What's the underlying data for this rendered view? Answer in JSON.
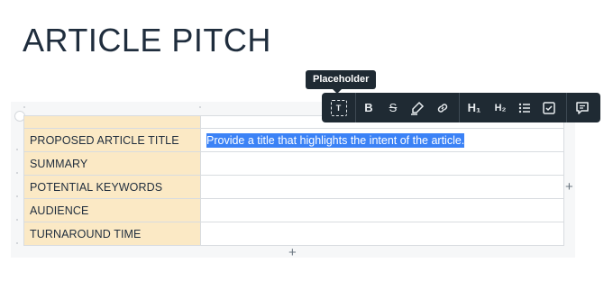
{
  "document": {
    "title": "ARTICLE PITCH"
  },
  "table": {
    "rows": [
      {
        "label": "PROPOSED ARTICLE TITLE",
        "value": "Provide a title that highlights the intent of the article."
      },
      {
        "label": "SUMMARY",
        "value": ""
      },
      {
        "label": "POTENTIAL KEYWORDS",
        "value": ""
      },
      {
        "label": "AUDIENCE",
        "value": ""
      },
      {
        "label": "TURNAROUND TIME",
        "value": ""
      }
    ],
    "add_column_glyph": "+",
    "add_row_glyph": "+"
  },
  "tooltip": {
    "text": "Placeholder"
  },
  "toolbar": {
    "placeholder_glyph": "T",
    "bold_glyph": "B",
    "strikethrough_glyph": "S",
    "heading1_glyph": "H₁",
    "heading2_glyph": "H₂",
    "icons": [
      "placeholder-icon",
      "bold-icon",
      "strikethrough-icon",
      "highlight-icon",
      "link-icon",
      "heading1-icon",
      "heading2-icon",
      "bullet-list-icon",
      "checkbox-icon",
      "comment-icon"
    ]
  },
  "colors": {
    "label_cell": "#fbe9c5",
    "selection": "#3b82f6",
    "toolbar": "#1f2a33"
  }
}
